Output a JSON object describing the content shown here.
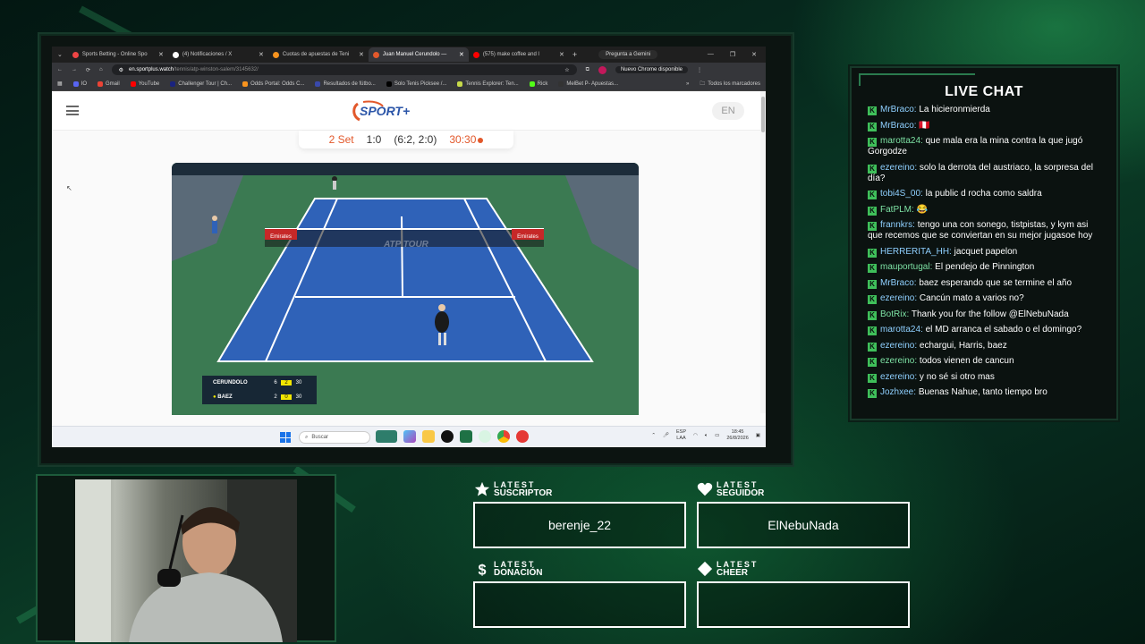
{
  "browser": {
    "tabs": [
      {
        "title": "Sports Betting - Online Spo",
        "color": "#e44"
      },
      {
        "title": "(4) Notificaciones / X",
        "color": "#fff"
      },
      {
        "title": "Cuotas de apuestas de Teni",
        "color": "#f7931e"
      },
      {
        "title": "Juan Manuel Cerundolo —",
        "color": "#e2582b"
      },
      {
        "title": "(575) make coffee and l",
        "color": "#ff0000"
      }
    ],
    "gemini": "Pregunta a Gemini",
    "url_host": "en.sportplus.watch",
    "url_path": "/tennis/atp-winston-salem/3145632/",
    "chrome_update": "Nuevo Chrome disponible",
    "bookmarks": [
      "IO",
      "Gmail",
      "YouTube",
      "Challenger Tour | Ch...",
      "Odds Portal: Odds C...",
      "Resultados de fútbo...",
      "Solo Tenis Picksee /...",
      "Tennis Explorer: Ten...",
      "Rick",
      "MelBet P- Apuestas..."
    ],
    "bookmarks_all": "Todos los marcadores"
  },
  "site": {
    "logo": "SPORT+",
    "lang": "EN",
    "score": {
      "set": "2 Set",
      "sets": "1:0",
      "games": "(6:2, 2:0)",
      "points": "30:30"
    },
    "video": {
      "court_ad": "ATP TOUR",
      "banner_left": "Emirates",
      "banner_right": "Emirates",
      "scoreboard": [
        {
          "name": "CERUNDOLO",
          "set1": "6",
          "set2": "2",
          "pts": "30"
        },
        {
          "name": "BAEZ",
          "set1": "2",
          "set2": "0",
          "pts": "30"
        }
      ]
    }
  },
  "taskbar": {
    "search": "Buscar",
    "lang_top": "ESP",
    "lang_bottom": "LAA",
    "time": "18:45",
    "date": "26/8/2026"
  },
  "chat": {
    "title": "LIVE CHAT",
    "messages": [
      {
        "user": "MrBraco",
        "text": "La hicieronmierda"
      },
      {
        "user": "MrBraco",
        "text": "🇵🇪"
      },
      {
        "user": "marotta24",
        "text": "que mala era la mina contra la que jugó Gorgodze"
      },
      {
        "user": "ezereino",
        "text": "solo la derrota del austriaco, la sorpresa del día?"
      },
      {
        "user": "tobi4S_00",
        "text": "la public d rocha como saldra"
      },
      {
        "user": "FatPLM",
        "text": "😂"
      },
      {
        "user": "frannkrs",
        "text": "tengo una con sonego, tistpistas, y kym asi que recemos que se conviertan en su mejor jugasoe hoy"
      },
      {
        "user": "HERRERITA_HH",
        "text": "jacquet papelon"
      },
      {
        "user": "mauportugal",
        "text": "El pendejo de Pinnington"
      },
      {
        "user": "MrBraco",
        "text": "baez esperando que se termine el año"
      },
      {
        "user": "ezereino",
        "text": "Cancún mato a varios no?"
      },
      {
        "user": "BotRix",
        "text": "Thank you for the follow @ElNebuNada"
      },
      {
        "user": "marotta24",
        "text": "el MD arranca el sabado o el domingo?"
      },
      {
        "user": "ezereino",
        "text": "echargui, Harris, baez"
      },
      {
        "user": "ezereino",
        "text": "todos vienen de cancun"
      },
      {
        "user": "ezereino",
        "text": "y no sé si otro mas"
      },
      {
        "user": "Jozhxee",
        "text": "Buenas Nahue, tanto tiempo bro"
      }
    ]
  },
  "stats": {
    "subscriber": {
      "top": "LATEST",
      "label": "SUSCRIPTOR",
      "value": "berenje_22",
      "icon": "star-icon"
    },
    "follower": {
      "top": "LATEST",
      "label": "SEGUIDOR",
      "value": "ElNebuNada",
      "icon": "heart-icon"
    },
    "donation": {
      "top": "LATEST",
      "label": "DONACIÓN",
      "value": "",
      "icon": "dollar-icon"
    },
    "cheer": {
      "top": "LATEST",
      "label": "CHEER",
      "value": "",
      "icon": "diamond-icon"
    }
  },
  "colors": {
    "accent": "#e2582b",
    "chat_badge": "#3fbf5a",
    "chat_user": "#8fd0ff"
  }
}
